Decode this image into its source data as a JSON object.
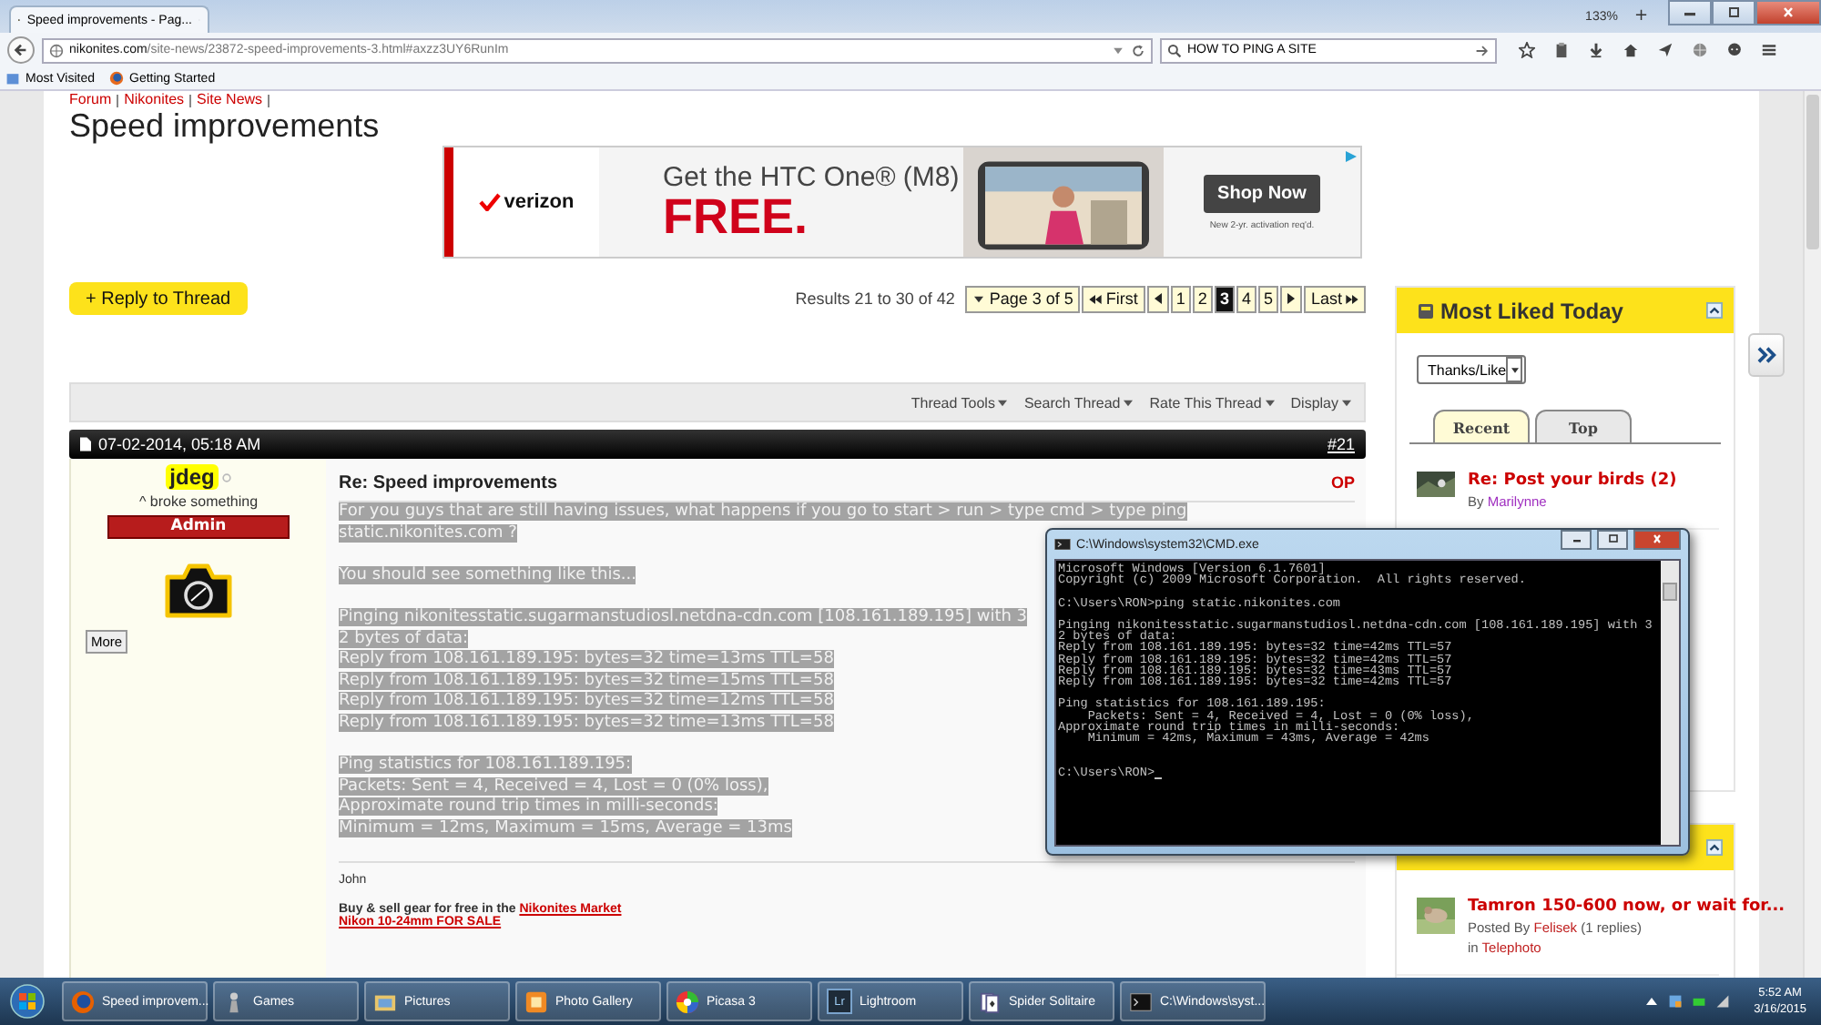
{
  "browser": {
    "tab_title": "Speed improvements - Pag...",
    "zoom": "133%",
    "zoom_in": "+",
    "url_host": "nikonites.com",
    "url_path": "/site-news/23872-speed-improvements-3.html#axzz3UY6RunIm",
    "search_value": "HOW TO PING A SITE",
    "bookmarks": [
      "Most Visited",
      "Getting Started"
    ]
  },
  "breadcrumb": [
    "Forum",
    "Nikonites",
    "Site News"
  ],
  "page_title": "Speed improvements",
  "ad": {
    "brand": "verizon",
    "headline": "Get the HTC One® (M8)",
    "offer": "FREE.",
    "button": "Shop Now",
    "fine_print": "New 2-yr. activation req'd."
  },
  "reply_button": "+ Reply to Thread",
  "results": "Results 21 to 30 of 42",
  "pagination": {
    "page_menu": "Page 3 of 5",
    "first": "First",
    "last": "Last",
    "pages": [
      {
        "label": "1",
        "selected": false
      },
      {
        "label": "2",
        "selected": false
      },
      {
        "label": "3",
        "selected": true
      },
      {
        "label": "4",
        "selected": false
      },
      {
        "label": "5",
        "selected": false
      }
    ]
  },
  "thread_tools": [
    "Thread Tools",
    "Search Thread",
    "Rate This Thread",
    "Display"
  ],
  "post": {
    "date": "07-02-2014, 05:18 AM",
    "number": "#21",
    "username": "jdeg",
    "online": false,
    "user_title": "^ broke something",
    "rank": "Admin",
    "more_button": "More",
    "title": "Re: Speed improvements",
    "op_badge": "OP",
    "highlighted": true,
    "blocks": [
      [
        "For you guys that are still having issues, what happens if you go to start > run > type cmd > type ping",
        "static.nikonites.com ?"
      ],
      [
        "You should see something like this..."
      ],
      [
        "Pinging nikonitesstatic.sugarmanstudiosl.netdna-cdn.com [108.161.189.195] with 3",
        "2 bytes of data:",
        "Reply from 108.161.189.195: bytes=32 time=13ms TTL=58",
        "Reply from 108.161.189.195: bytes=32 time=15ms TTL=58",
        "Reply from 108.161.189.195: bytes=32 time=12ms TTL=58",
        "Reply from 108.161.189.195: bytes=32 time=13ms TTL=58"
      ],
      [
        "Ping statistics for 108.161.189.195:",
        "Packets: Sent = 4, Received = 4, Lost = 0 (0% loss),",
        "Approximate round trip times in milli-seconds:",
        "Minimum = 12ms, Maximum = 15ms, Average = 13ms"
      ]
    ],
    "signature_name": "John",
    "signature_text": "Buy & sell gear for free in the",
    "signature_link": "Nikonites Market",
    "sale_link": "Nikon 10-24mm FOR SALE"
  },
  "sidebar": {
    "most_liked": {
      "title": "Most Liked Today",
      "filter": "Thanks/Like",
      "tabs": [
        {
          "label": "Recent",
          "selected": true
        },
        {
          "label": "Top",
          "selected": false
        }
      ],
      "items": [
        {
          "title": "Re: Post your birds (2)",
          "by_label": "By",
          "author": "Marilynne"
        }
      ]
    },
    "threads": [
      {
        "title": "Tamron 150-600 now, or wait for...",
        "posted_by": "Posted By",
        "author": "Felisek",
        "replies": "(1 replies)",
        "in_label": "in",
        "forum": "Telephoto"
      }
    ]
  },
  "cmd": {
    "title": "C:\\Windows\\system32\\CMD.exe",
    "blocks": [
      [
        "Microsoft Windows [Version 6.1.7601]",
        "Copyright (c) 2009 Microsoft Corporation.  All rights reserved."
      ],
      [
        "C:\\Users\\RON>ping static.nikonites.com"
      ],
      [
        "Pinging nikonitesstatic.sugarmanstudiosl.netdna-cdn.com [108.161.189.195] with 3",
        "2 bytes of data:",
        "Reply from 108.161.189.195: bytes=32 time=42ms TTL=57",
        "Reply from 108.161.189.195: bytes=32 time=42ms TTL=57",
        "Reply from 108.161.189.195: bytes=32 time=43ms TTL=57",
        "Reply from 108.161.189.195: bytes=32 time=42ms TTL=57"
      ],
      [
        "Ping statistics for 108.161.189.195:",
        "    Packets: Sent = 4, Received = 4, Lost = 0 (0% loss),",
        "Approximate round trip times in milli-seconds:",
        "    Minimum = 42ms, Maximum = 43ms, Average = 42ms"
      ]
    ],
    "prompt": "C:\\Users\\RON>"
  },
  "taskbar": {
    "items": [
      {
        "label": "Speed improvem...",
        "kind": "firefox"
      },
      {
        "label": "Games",
        "kind": "chess"
      },
      {
        "label": "Pictures",
        "kind": "pictures"
      },
      {
        "label": "Photo Gallery",
        "kind": "gallery"
      },
      {
        "label": "Picasa 3",
        "kind": "picasa"
      },
      {
        "label": "Lightroom",
        "kind": "lightroom",
        "badge": "Lr"
      },
      {
        "label": "Spider Solitaire",
        "kind": "solitaire"
      },
      {
        "label": "C:\\Windows\\syst...",
        "kind": "cmd"
      }
    ],
    "time": "5:52 AM",
    "date": "3/16/2015"
  }
}
